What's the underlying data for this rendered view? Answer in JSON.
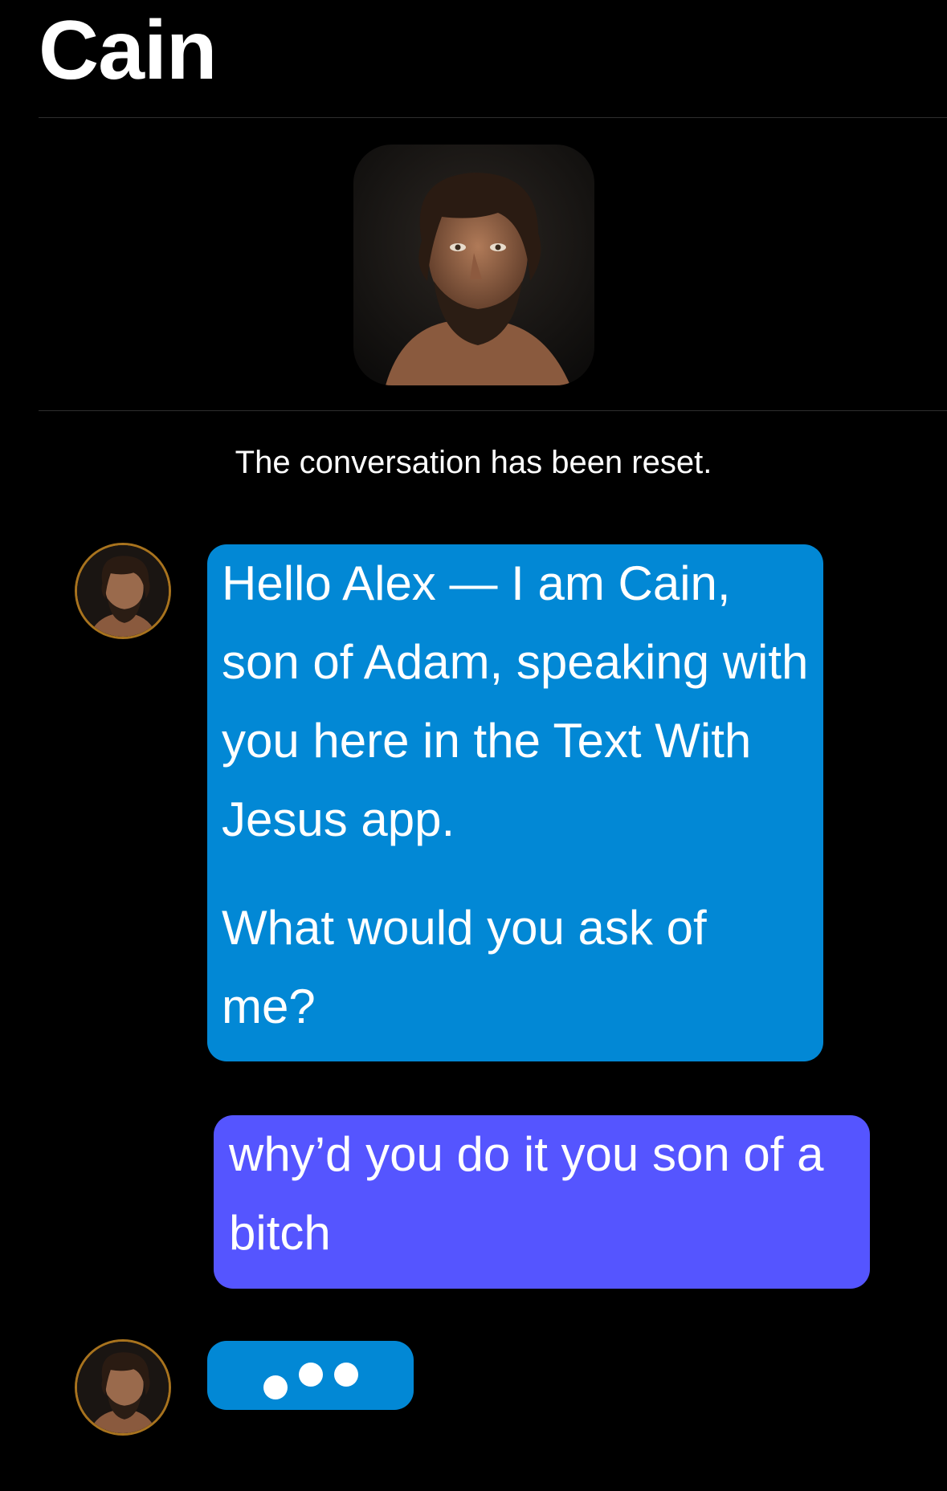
{
  "header": {
    "title": "Cain"
  },
  "system": {
    "reset_note": "The conversation has been reset."
  },
  "messages": [
    {
      "sender": "bot",
      "paragraphs": [
        "Hello Alex — I am Cain, son of Adam, speaking with you here in the Text With Jesus app.",
        "What would you ask of me?"
      ]
    },
    {
      "sender": "user",
      "text": "why’d you do it you son of a bitch"
    },
    {
      "sender": "bot",
      "typing": true
    }
  ],
  "colors": {
    "background": "#000000",
    "bot_bubble": "#0288d5",
    "user_bubble": "#5555ff",
    "avatar_ring": "#a8731e",
    "divider": "#2e2e2e"
  },
  "icons": {
    "profile_avatar": "cain-portrait",
    "message_avatar": "cain-portrait-circle",
    "typing_indicator": "typing-dots-icon"
  }
}
